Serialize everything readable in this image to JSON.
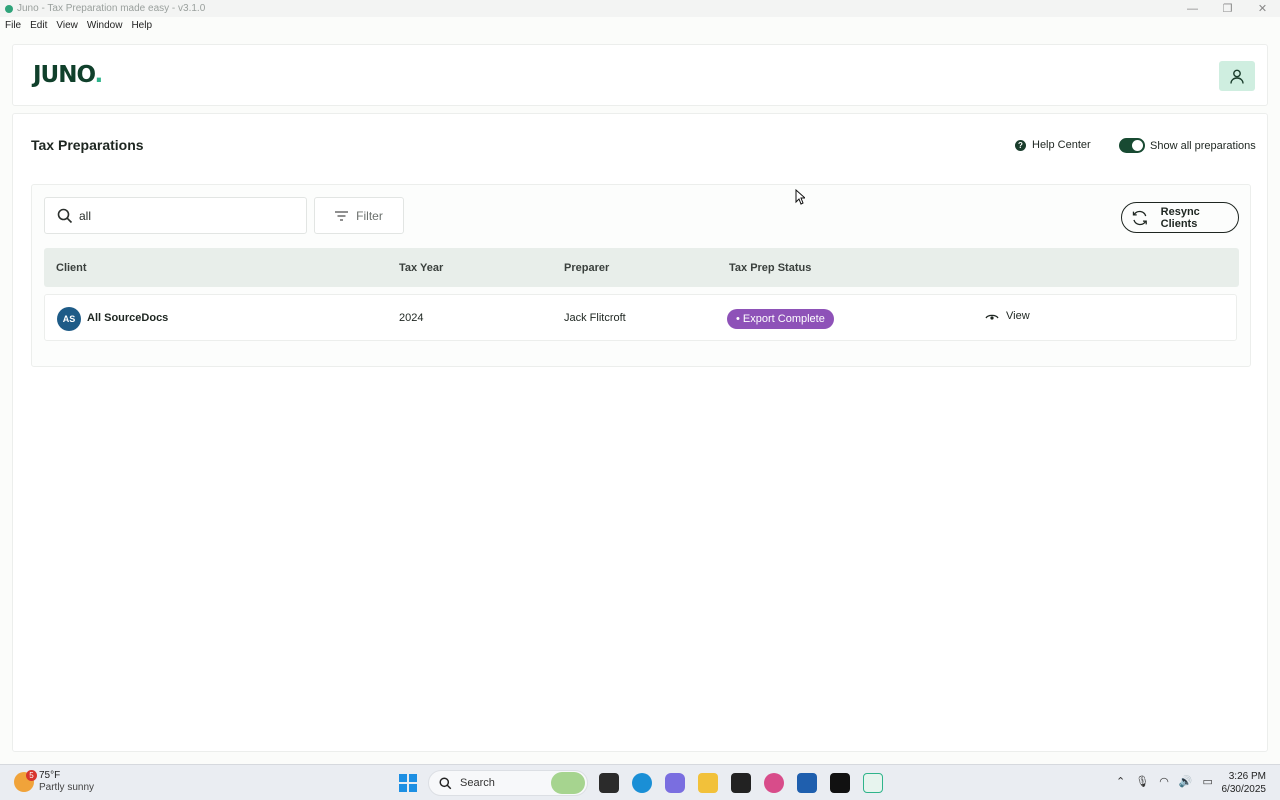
{
  "window": {
    "title": "Juno - Tax Preparation made easy - v3.1.0",
    "controls": [
      "—",
      "❐",
      "✕"
    ]
  },
  "menu": [
    "File",
    "Edit",
    "View",
    "Window",
    "Help"
  ],
  "header": {
    "logo_main": "JUNO",
    "logo_dot": "."
  },
  "page": {
    "title": "Tax Preparations",
    "help_label": "Help Center",
    "toggle_label": "Show all preparations",
    "toggle_on": true
  },
  "toolbar": {
    "search_value": "all",
    "filter_label": "Filter",
    "resync_label": "Resync Clients"
  },
  "table": {
    "columns": [
      "Client",
      "Tax Year",
      "Preparer",
      "Tax Prep Status"
    ],
    "rows": [
      {
        "initials": "AS",
        "client": "All SourceDocs",
        "tax_year": "2024",
        "preparer": "Jack Flitcroft",
        "status": "• Export Complete",
        "action": "View"
      }
    ]
  },
  "colors": {
    "brand_dark": "#10402b",
    "brand_accent": "#2fb48b",
    "status_purple": "#8e52b8",
    "avatar_blue": "#1e5b87"
  },
  "taskbar": {
    "weather_badge": "5",
    "temperature": "75°F",
    "weather_desc": "Partly sunny",
    "search_label": "Search",
    "time": "3:26 PM",
    "date": "6/30/2025"
  }
}
